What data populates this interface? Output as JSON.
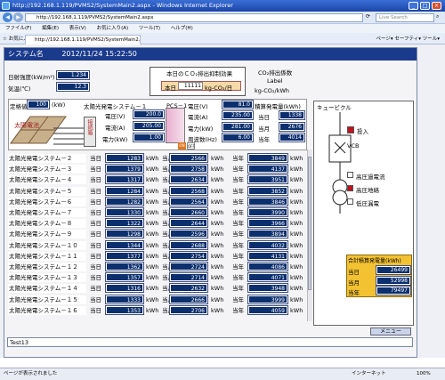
{
  "browser": {
    "title": "http://192.168.1.119/PVMS2/SystemMain2.aspx - Windows Internet Explorer",
    "address": "http://192.168.1.119/PVMS2/SystemMain2.aspx",
    "search_engine": "Live Search",
    "menu": [
      "ファイル(F)",
      "編集(E)",
      "表示(V)",
      "お気に入り(A)",
      "ツール(T)",
      "ヘルプ(H)"
    ],
    "favorites": "お気に入り",
    "tab_title": "http://192.168.1.119/PVMS2/SystemMain2.aspx",
    "tools": "ページ▾  セーフティ▾  ツール▾",
    "status_left": "ページが表示されました",
    "status_zone": "インターネット",
    "zoom": "100%"
  },
  "app": {
    "title": "システム名",
    "datetime": "2012/11/24 15:22:50",
    "irradiance_label": "日射強度(kW/m²)",
    "irradiance_value": "1.234",
    "temp_label": "気温(℃)",
    "temp_value": "12.3",
    "co2_title": "本日のＣＯ₂排出抑制効果",
    "co2_today_label": "本日",
    "co2_today_value": "11111",
    "co2_unit": "kg-CO₂/日",
    "co2_factor_title": "CO₂排出係数",
    "co2_factor_label": "Label",
    "co2_factor_unit": "kg-CO₂/kWh",
    "rated_label": "定格値",
    "rated_value": "100",
    "rated_unit": "(kW)",
    "sys1_label": "太陽光発電システム－１",
    "panel_label": "太陽電池",
    "box_label": "接続箱",
    "pcs_label": "PCS－1",
    "sys1_voltage_label": "電圧(V)",
    "sys1_voltage": "200.0",
    "sys1_current_label": "電流(A)",
    "sys1_current": "205.00",
    "sys1_power_label": "電力(kW)",
    "sys1_power": "1.00",
    "pcs_voltage_label": "電圧(V)",
    "pcs_voltage": "81.0",
    "pcs_current_label": "電流(A)",
    "pcs_current": "235.00",
    "pcs_power_label": "電力(kW)",
    "pcs_power": "281.00",
    "pcs_freq_label": "周波数(Hz)",
    "pcs_freq": "6.00",
    "acc_title": "積算発電量(kWh)",
    "acc_today_label": "当日",
    "acc_today": "1338",
    "acc_month_label": "当月",
    "acc_month": "2676",
    "acc_year_label": "当年",
    "acc_year": "4014",
    "on_label": "ON",
    "off_label": "OFF",
    "rows": [
      {
        "name": "太陽光発電システム－２",
        "today": "1283",
        "month": "2566",
        "year": "3849"
      },
      {
        "name": "太陽光発電システム－３",
        "today": "1379",
        "month": "2758",
        "year": "4137"
      },
      {
        "name": "太陽光発電システム－４",
        "today": "1317",
        "month": "2634",
        "year": "3951"
      },
      {
        "name": "太陽光発電システム－５",
        "today": "1284",
        "month": "2568",
        "year": "3852"
      },
      {
        "name": "太陽光発電システム－６",
        "today": "1282",
        "month": "2564",
        "year": "3846"
      },
      {
        "name": "太陽光発電システム－７",
        "today": "1330",
        "month": "2660",
        "year": "3990"
      },
      {
        "name": "太陽光発電システム－８",
        "today": "1322",
        "month": "2644",
        "year": "3966"
      },
      {
        "name": "太陽光発電システム－９",
        "today": "1298",
        "month": "2596",
        "year": "3894"
      },
      {
        "name": "太陽光発電システム－１０",
        "today": "1344",
        "month": "2688",
        "year": "4032"
      },
      {
        "name": "太陽光発電システム－１１",
        "today": "1377",
        "month": "2754",
        "year": "4131"
      },
      {
        "name": "太陽光発電システム－１２",
        "today": "1362",
        "month": "2724",
        "year": "4086"
      },
      {
        "name": "太陽光発電システム－１３",
        "today": "1357",
        "month": "2714",
        "year": "4071"
      },
      {
        "name": "太陽光発電システム－１４",
        "today": "1316",
        "month": "2632",
        "year": "3948"
      },
      {
        "name": "太陽光発電システム－１５",
        "today": "1333",
        "month": "2666",
        "year": "3999"
      },
      {
        "name": "太陽光発電システム－１６",
        "today": "1353",
        "month": "2706",
        "year": "4059"
      }
    ],
    "row_today_label": "当日",
    "row_month_label": "当月",
    "row_year_label": "当年",
    "kwh_unit": "kWh",
    "cubicle_title": "キュービクル",
    "closed_label": "投入",
    "vcb_label": "VCB",
    "alarm1": "高圧過電流",
    "alarm2": "高圧地絡",
    "alarm3": "低圧漏電",
    "total_title": "合計積算発電量(kWh)",
    "total_today_label": "当日",
    "total_today": "26499",
    "total_month_label": "当月",
    "total_month": "52998",
    "total_year_label": "当年",
    "total_year": "79497",
    "menu_button": "メニュー",
    "status_text": "Test13"
  },
  "colors": {
    "title_bar": "#1a3a8c",
    "value_box": "#0c2f6e",
    "alarm_on": "#c0121c",
    "total_panel": "#f3c232"
  }
}
